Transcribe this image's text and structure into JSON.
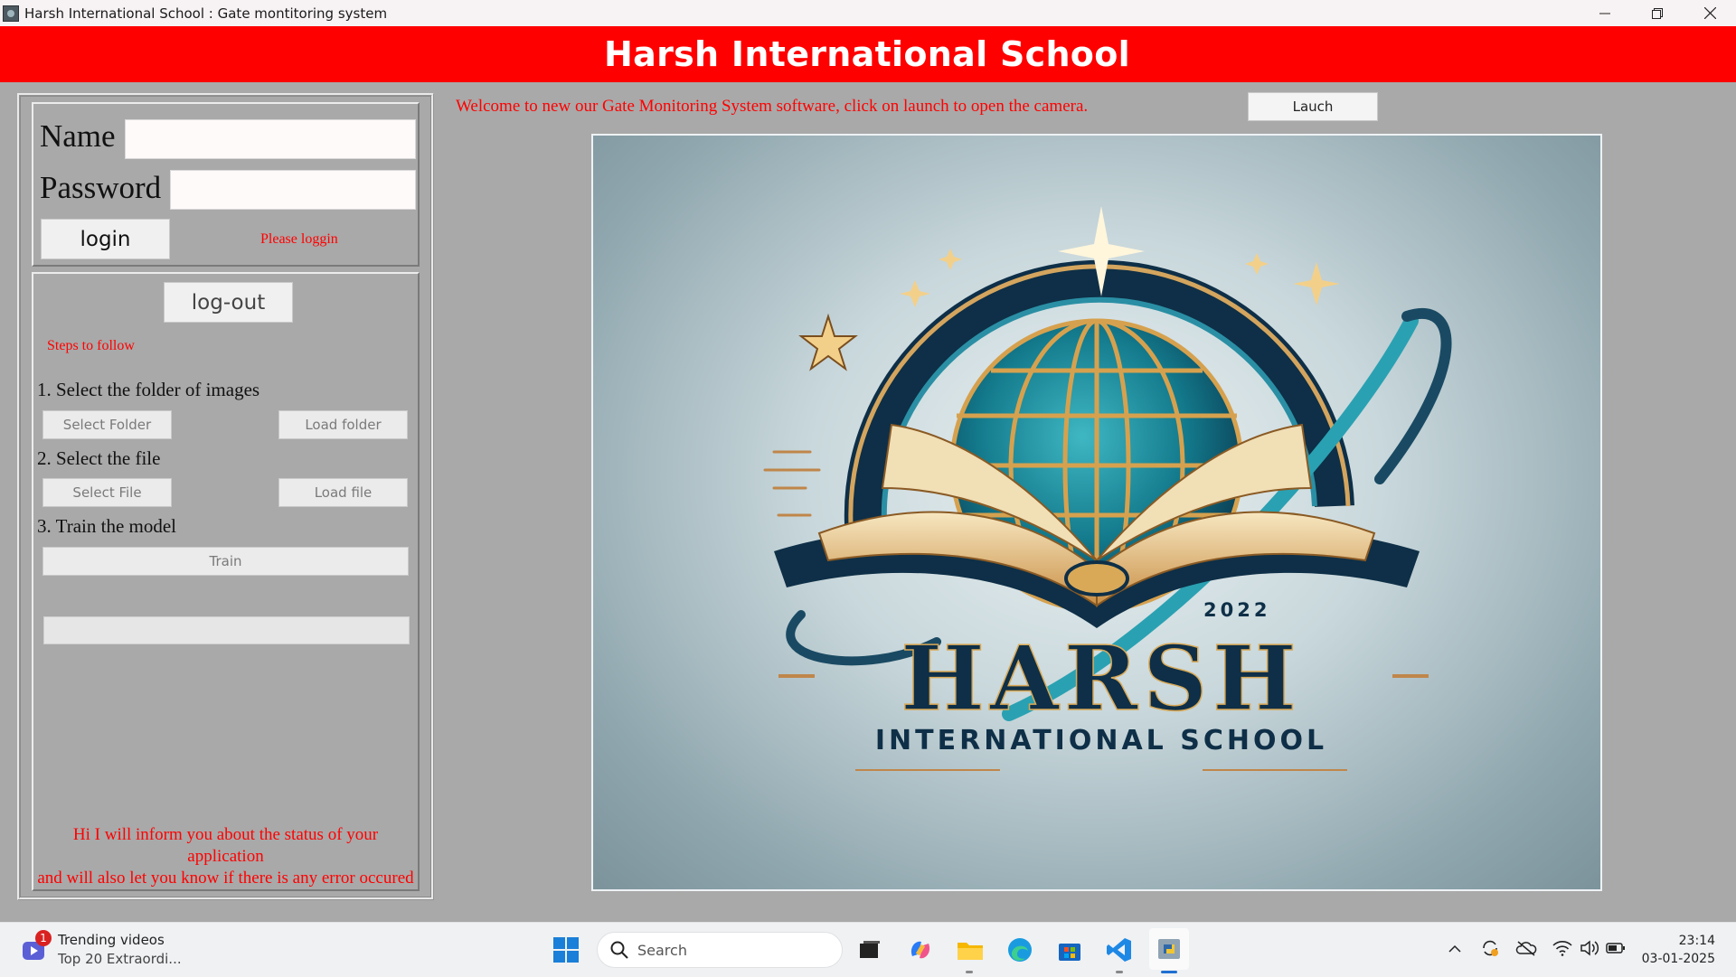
{
  "window": {
    "title": "Harsh International School : Gate montitoring system"
  },
  "header": {
    "title": "Harsh International School"
  },
  "login": {
    "name_label": "Name",
    "name_value": "",
    "password_label": "Password",
    "password_value": "",
    "login_button": "login",
    "status": "Please loggin"
  },
  "steps": {
    "logout_button": "log-out",
    "heading": "Steps to follow",
    "step1": "1. Select the folder of images",
    "select_folder_button": "Select Folder",
    "load_folder_button": "Load folder",
    "step2": "2. Select the file",
    "select_file_button": "Select File",
    "load_file_button": "Load file",
    "step3": "3. Train the model",
    "train_button": "Train",
    "progress": 0,
    "status_message_line1": "Hi I will inform you about the status of your application",
    "status_message_line2": "and will also let you know if there is any error occured"
  },
  "main": {
    "welcome_text": "Welcome to new our Gate Monitoring System software, click on launch to open the camera.",
    "launch_button": "Lauch",
    "logo": {
      "year": "2022",
      "name": "HARSH",
      "subtitle": "INTERNATIONAL SCHOOL"
    }
  },
  "taskbar": {
    "widget_badge": "1",
    "widget_title": "Trending videos",
    "widget_subtitle": "Top 20 Extraordi...",
    "search_placeholder": "Search",
    "time": "23:14",
    "date": "03-01-2025"
  },
  "colors": {
    "header_red": "#fe0000",
    "panel_gray": "#a9a9a9",
    "status_red": "#ff0000"
  }
}
